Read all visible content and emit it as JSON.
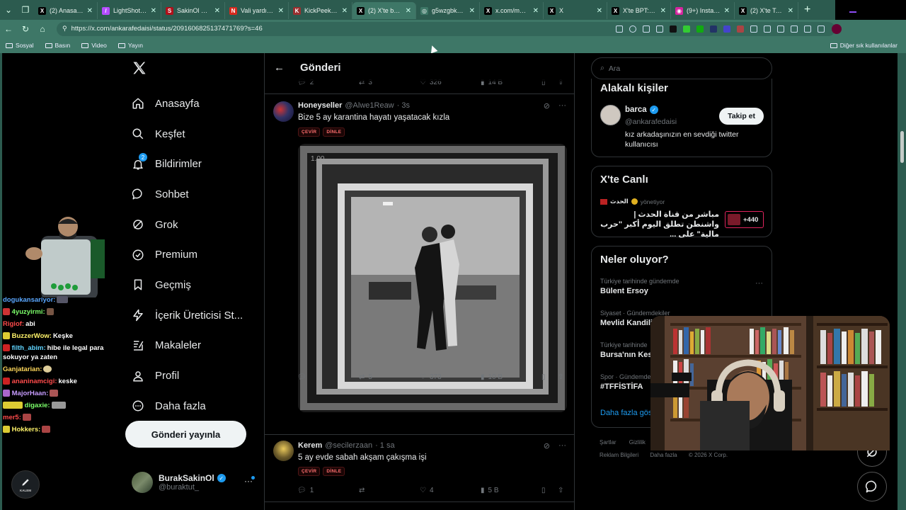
{
  "browser": {
    "tabs": [
      {
        "label": "(2) Anasayfa / X",
        "icon": "x-icon",
        "color": "#000000",
        "glyph": "X"
      },
      {
        "label": "LightShot taraf...",
        "icon": "lightshot-icon",
        "color": "#b44cff",
        "glyph": "/"
      },
      {
        "label": "SakinOl Haber",
        "icon": "sakinol-icon",
        "color": "#b0101a",
        "glyph": "S"
      },
      {
        "label": "Vali yardımcısı",
        "icon": "news-icon",
        "color": "#d62a1e",
        "glyph": "N"
      },
      {
        "label": "KickPeek - Real...",
        "icon": "kickpeek-icon",
        "color": "#9a2f2f",
        "glyph": "K"
      },
      {
        "label": "(2) X'te ba...",
        "icon": "x-icon",
        "color": "#000000",
        "glyph": "X",
        "active": true
      },
      {
        "label": "g5wzgbkm.jpg",
        "icon": "globe-icon",
        "color": "#3e7767",
        "glyph": "◎"
      },
      {
        "label": "x.com/mercan...",
        "icon": "x-icon",
        "color": "#000000",
        "glyph": "X"
      },
      {
        "label": "X",
        "icon": "x-icon",
        "color": "#000000",
        "glyph": "X"
      },
      {
        "label": "X'te BPT: \"Ank...",
        "icon": "x-icon",
        "color": "#000000",
        "glyph": "X"
      },
      {
        "label": "(9+) Instagram",
        "icon": "instagram-icon",
        "color": "#d6249f",
        "glyph": "◉"
      },
      {
        "label": "(2) X'te Toygar...",
        "icon": "x-icon",
        "color": "#000000",
        "glyph": "X"
      }
    ],
    "url": "https://x.com/ankarafedaisi/status/2091606825137471769?s=46",
    "bookmarks": [
      "Sosyal",
      "Basın",
      "Video",
      "Yayın"
    ],
    "bookmarks_right": "Diğer sık kullanılanlar"
  },
  "nav": {
    "items": [
      {
        "label": "Anasayfa",
        "icon": "home-icon"
      },
      {
        "label": "Keşfet",
        "icon": "search-icon"
      },
      {
        "label": "Bildirimler",
        "icon": "bell-icon",
        "badge": "2"
      },
      {
        "label": "Sohbet",
        "icon": "chat-icon"
      },
      {
        "label": "Grok",
        "icon": "grok-icon"
      },
      {
        "label": "Premium",
        "icon": "premium-icon"
      },
      {
        "label": "Geçmiş",
        "icon": "bookmark-icon"
      },
      {
        "label": "İçerik Üreticisi St...",
        "icon": "lightning-icon"
      },
      {
        "label": "Makaleler",
        "icon": "article-icon"
      },
      {
        "label": "Profil",
        "icon": "profile-icon"
      },
      {
        "label": "Daha fazla",
        "icon": "more-circle-icon"
      }
    ],
    "post_button": "Gönderi yayınla",
    "account": {
      "name": "BurakSakinOl",
      "handle": "@buraktut_"
    }
  },
  "main": {
    "title": "Gönderi",
    "top_actions": {
      "reply": "2",
      "retweet": "3",
      "like": "326",
      "views": "14 B"
    },
    "tweets": [
      {
        "name": "Honeyseller",
        "handle": "@Alwe1Reaw",
        "time": "· 3s",
        "text": "Bize 5 ay karantina hayatı yaşatacak kızla",
        "chips": [
          "ÇEVİR",
          "DİNLE"
        ],
        "media_time": "1.00",
        "replies": "",
        "retweets": "5",
        "likes": "373",
        "views": "10 B"
      },
      {
        "name": "Kerem",
        "handle": "@secilerzaan",
        "time": "· 1 sa",
        "text": "5 ay evde sabah akşam çakışma işi",
        "chips": [
          "ÇEVİR",
          "DİNLE"
        ],
        "replies": "1",
        "retweets": "",
        "likes": "4",
        "views": "5 B"
      }
    ]
  },
  "sidebar": {
    "search_placeholder": "Ara",
    "related": {
      "title": "Alakalı kişiler",
      "name": "barca",
      "handle": "@ankarafedaisi",
      "bio": "kız arkadaşınızın en sevdiği twitter kullanıcısı",
      "follow": "Takip et"
    },
    "live": {
      "title": "X'te Canlı",
      "host": "الحدث",
      "hosting": "yönetiyor",
      "text": "مباشر من قناة الحدث | واشنطن تطلق اليوم أكبر \"حرب مالية\" على ...",
      "count": "+440"
    },
    "trends": {
      "title": "Neler oluyor?",
      "items": [
        {
          "context": "Türkiye tarihinde gündemde",
          "topic": "Bülent Ersoy"
        },
        {
          "context": "Siyaset · Gündemdekiler",
          "topic": "Mevlid Kandili"
        },
        {
          "context": "Türkiye tarihinde",
          "topic": "Bursa'nın Kes..."
        },
        {
          "context": "Spor · Gündemde",
          "topic": "#TFFİSTİFA"
        }
      ],
      "more": "Daha fazla göster"
    },
    "footer": [
      "Şartlar",
      "Gizlilik",
      "Reklam Bilgileri",
      "Daha fazla",
      "© 2026 X Corp."
    ]
  },
  "stream_chat": [
    {
      "user": "dogukansariyor:",
      "color": "#5aa7ff",
      "msg": ""
    },
    {
      "user": "4yuzyirmi:",
      "color": "#7cff6a",
      "msg": ""
    },
    {
      "user": "Rigiof:",
      "color": "#ff4b4b",
      "msg": "abi"
    },
    {
      "user": "BuzzerWow:",
      "color": "#fff36a",
      "msg": "Keşke"
    },
    {
      "user": "filth_abim:",
      "color": "#5fd4ff",
      "msg": "hibe ile legal para sokuyor ya zaten"
    },
    {
      "user": "Ganjatarian:",
      "color": "#ffd85a",
      "msg": ""
    },
    {
      "user": "ananinamcigi:",
      "color": "#ff4b4b",
      "msg": "keske"
    },
    {
      "user": "MajorHaan:",
      "color": "#c79cff",
      "msg": ""
    },
    {
      "user": "digaxie:",
      "color": "#7cff6a",
      "msg": ""
    },
    {
      "user": "mer5:",
      "color": "#ff4b4b",
      "msg": ""
    },
    {
      "user": "Hokkers:",
      "color": "#fff36a",
      "msg": ""
    }
  ],
  "overlay": {
    "kalem": "KALEM"
  },
  "colors": {
    "accent": "#1d9bf0",
    "chrome": "#3e7767",
    "tabbar": "#2c5b4f"
  }
}
